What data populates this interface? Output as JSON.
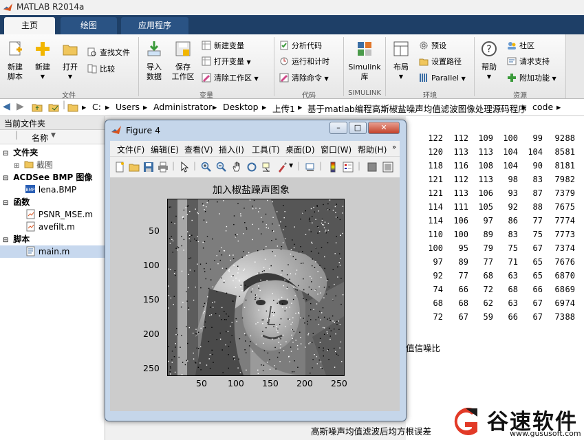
{
  "window": {
    "title": "MATLAB R2014a"
  },
  "ribbon_tabs": [
    "主页",
    "绘图",
    "应用程序"
  ],
  "ribbon": {
    "file_group": {
      "label": "文件",
      "new_script": "新建\n脚本",
      "new": "新建",
      "open": "打开",
      "find_files": "查找文件",
      "compare": "比较"
    },
    "variable_group": {
      "label": "变量",
      "import_data": "导入\n数据",
      "save_workspace": "保存\n工作区",
      "new_variable": "新建变量",
      "open_variable": "打开变量",
      "clear_workspace": "清除工作区"
    },
    "code_group": {
      "label": "代码",
      "analyze_code": "分析代码",
      "run_and_time": "运行和计时",
      "clear_commands": "清除命令"
    },
    "simulink_group": {
      "label": "SIMULINK",
      "library": "Simulink\n库"
    },
    "environment_group": {
      "label": "环境",
      "layout": "布局",
      "preferences": "预设",
      "set_path": "设置路径",
      "parallel": "Parallel"
    },
    "resources_group": {
      "label": "资源",
      "help": "帮助",
      "community": "社区",
      "request_support": "请求支持",
      "add_ons": "附加功能"
    }
  },
  "address_bar": {
    "path": [
      "C:",
      "Users",
      "Administrator",
      "Desktop",
      "上传1",
      "基于matlab编程高斯椒盐噪声均值滤波图像处理源码程序",
      "code"
    ]
  },
  "current_folder": {
    "title": "当前文件夹",
    "column_header": "名称",
    "groups": [
      {
        "label": "文件夹",
        "items": [
          "截图"
        ]
      },
      {
        "label": "ACDSee BMP 图像",
        "items": [
          "lena.BMP"
        ]
      },
      {
        "label": "函数",
        "items": [
          "PSNR_MSE.m",
          "avefilt.m"
        ]
      },
      {
        "label": "脚本",
        "items": [
          "main.m"
        ]
      }
    ]
  },
  "figure": {
    "title": "Figure 4",
    "menu": [
      "文件(F)",
      "编辑(E)",
      "查看(V)",
      "插入(I)",
      "工具(T)",
      "桌面(D)",
      "窗口(W)",
      "帮助(H)"
    ],
    "plot_title": "加入椒盐躁声图象",
    "y_ticks": [
      "50",
      "100",
      "150",
      "200",
      "250"
    ],
    "x_ticks": [
      "50",
      "100",
      "150",
      "200",
      "250"
    ]
  },
  "command_window": {
    "rows": [
      [
        "122",
        "112",
        "109",
        "100",
        "99",
        "92",
        "88"
      ],
      [
        "120",
        "113",
        "113",
        "104",
        "104",
        "85",
        "81"
      ],
      [
        "118",
        "116",
        "108",
        "104",
        "90",
        "81",
        "81"
      ],
      [
        "121",
        "112",
        "113",
        "98",
        "83",
        "79",
        "82"
      ],
      [
        "121",
        "113",
        "106",
        "93",
        "87",
        "73",
        "79"
      ],
      [
        "114",
        "111",
        "105",
        "92",
        "88",
        "76",
        "75"
      ],
      [
        "114",
        "106",
        "97",
        "86",
        "77",
        "77",
        "74"
      ],
      [
        "110",
        "100",
        "89",
        "83",
        "75",
        "77",
        "73"
      ],
      [
        "100",
        "95",
        "79",
        "75",
        "67",
        "73",
        "74"
      ],
      [
        "97",
        "89",
        "77",
        "71",
        "65",
        "76",
        "76"
      ],
      [
        "92",
        "77",
        "68",
        "63",
        "65",
        "68",
        "70"
      ],
      [
        "74",
        "66",
        "72",
        "68",
        "66",
        "68",
        "69"
      ],
      [
        "68",
        "68",
        "62",
        "63",
        "67",
        "69",
        "74"
      ],
      [
        "72",
        "67",
        "59",
        "66",
        "67",
        "73",
        "88"
      ]
    ],
    "text1": "值信噪比",
    "text2": "高斯噪声均值滤波后均方根误差"
  },
  "watermark": {
    "name": "谷速软件",
    "url": "www.gususoft.com"
  },
  "colors": {
    "ribbon_tab_bg": "#1e3f67",
    "accent": "#e23a27"
  }
}
